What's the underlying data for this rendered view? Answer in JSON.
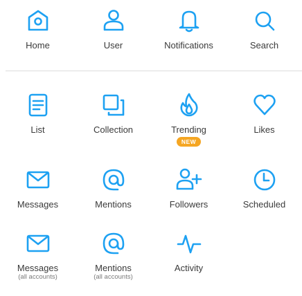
{
  "theme": {
    "accent": "#1da1f2",
    "badge": "#f5a623"
  },
  "row1": [
    {
      "id": "home",
      "icon": "home-icon",
      "label": "Home"
    },
    {
      "id": "user",
      "icon": "user-icon",
      "label": "User"
    },
    {
      "id": "notifications",
      "icon": "bell-icon",
      "label": "Notifications"
    },
    {
      "id": "search",
      "icon": "search-icon",
      "label": "Search"
    }
  ],
  "row2": [
    {
      "id": "list",
      "icon": "list-icon",
      "label": "List"
    },
    {
      "id": "collection",
      "icon": "collection-icon",
      "label": "Collection"
    },
    {
      "id": "trending",
      "icon": "flame-icon",
      "label": "Trending",
      "badge": "NEW"
    },
    {
      "id": "likes",
      "icon": "heart-icon",
      "label": "Likes"
    }
  ],
  "row3": [
    {
      "id": "messages",
      "icon": "envelope-icon",
      "label": "Messages"
    },
    {
      "id": "mentions",
      "icon": "at-sign-icon",
      "label": "Mentions"
    },
    {
      "id": "followers",
      "icon": "add-user-icon",
      "label": "Followers"
    },
    {
      "id": "scheduled",
      "icon": "clock-icon",
      "label": "Scheduled"
    }
  ],
  "row4": [
    {
      "id": "messages-all",
      "icon": "envelope-icon",
      "label": "Messages",
      "sub": "(all accounts)"
    },
    {
      "id": "mentions-all",
      "icon": "at-sign-icon",
      "label": "Mentions",
      "sub": "(all accounts)"
    },
    {
      "id": "activity",
      "icon": "activity-icon",
      "label": "Activity"
    }
  ]
}
